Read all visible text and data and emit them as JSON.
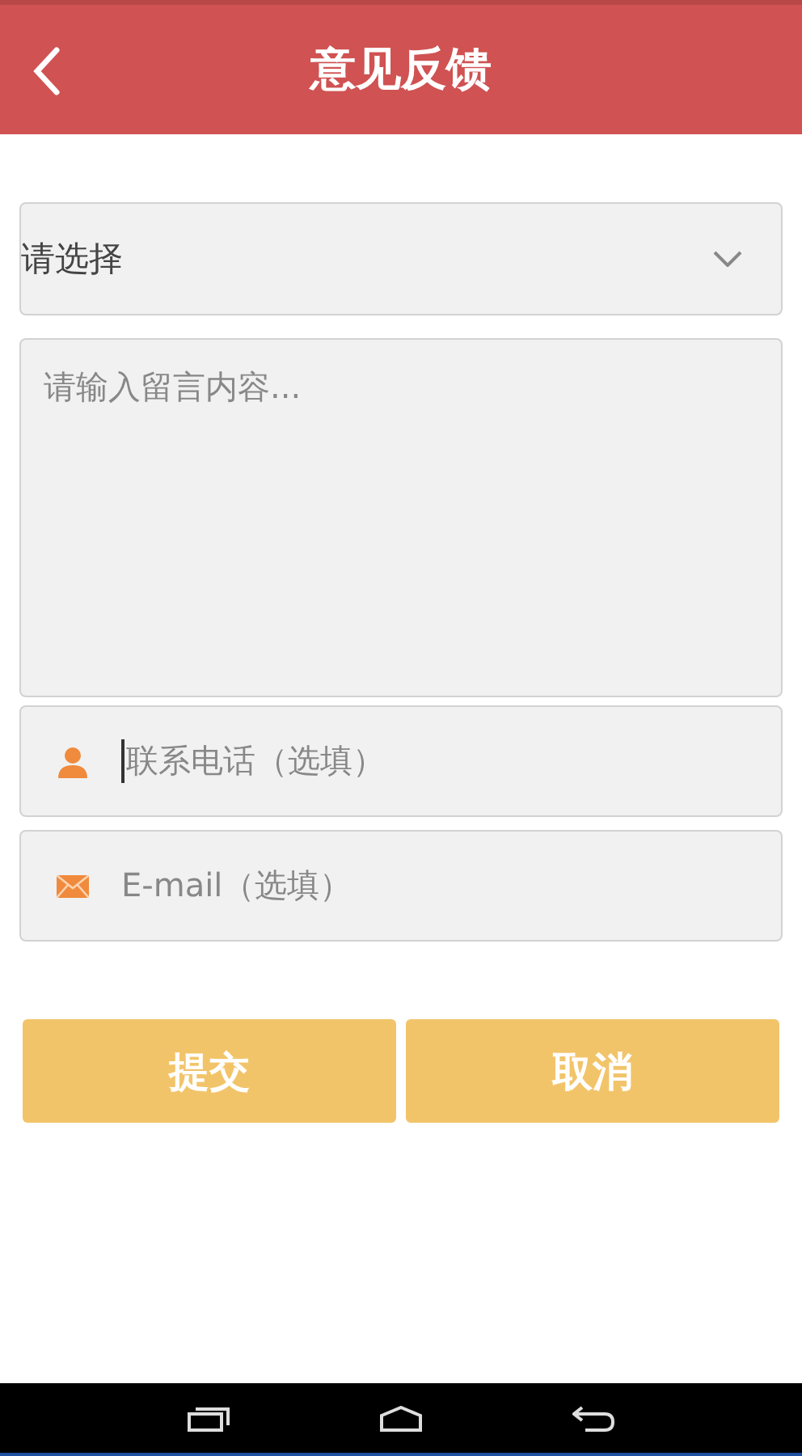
{
  "header": {
    "title": "意见反馈"
  },
  "form": {
    "category": {
      "value": "请选择"
    },
    "message": {
      "placeholder": "请输入留言内容..."
    },
    "phone": {
      "placeholder": "联系电话（选填）",
      "focused": true
    },
    "email": {
      "placeholder": "E-mail（选填）",
      "focused": false
    }
  },
  "buttons": [
    {
      "label": "提交"
    },
    {
      "label": "取消"
    }
  ]
}
